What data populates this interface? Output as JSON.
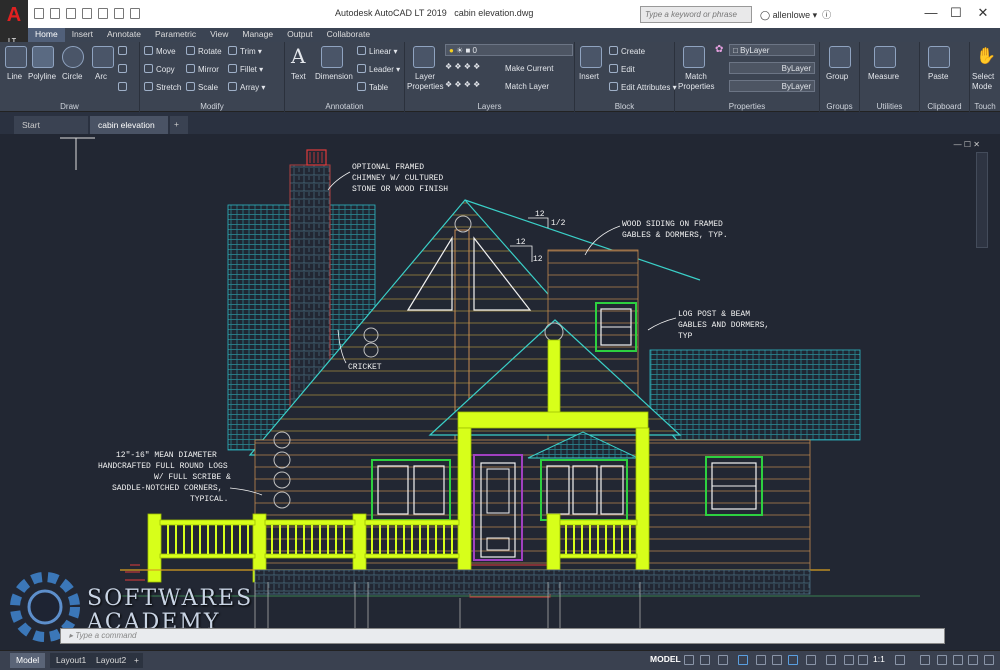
{
  "app": {
    "logo_text": "A",
    "logo_sub": "LT",
    "title": "Autodesk AutoCAD LT 2019",
    "filename": "cabin elevation.dwg",
    "search_placeholder": "Type a keyword or phrase",
    "user_name": "allenlowe"
  },
  "ribbon_tabs": [
    "Home",
    "Insert",
    "Annotate",
    "Parametric",
    "View",
    "Manage",
    "Output",
    "Collaborate"
  ],
  "ribbon": {
    "draw": {
      "label": "Draw",
      "line": "Line",
      "polyline": "Polyline",
      "circle": "Circle",
      "arc": "Arc"
    },
    "modify": {
      "label": "Modify",
      "move": "Move",
      "rotate": "Rotate",
      "trim": "Trim",
      "copy": "Copy",
      "mirror": "Mirror",
      "fillet": "Fillet",
      "stretch": "Stretch",
      "scale": "Scale",
      "array": "Array"
    },
    "annotation": {
      "label": "Annotation",
      "text": "Text",
      "dimension": "Dimension",
      "linear": "Linear",
      "leader": "Leader",
      "table": "Table"
    },
    "layers": {
      "label": "Layers",
      "layer_properties": "Layer Properties",
      "current_layer": "0",
      "make_current": "Make Current",
      "match_layer": "Match Layer"
    },
    "block": {
      "label": "Block",
      "insert": "Insert",
      "create": "Create",
      "edit": "Edit",
      "edit_attributes": "Edit Attributes"
    },
    "properties": {
      "label": "Properties",
      "match_properties": "Match Properties",
      "color": "ByLayer",
      "linetype": "ByLayer",
      "lineweight": "ByLayer"
    },
    "groups": {
      "label": "Groups",
      "group": "Group"
    },
    "utilities": {
      "label": "Utilities",
      "measure": "Measure"
    },
    "clipboard": {
      "label": "Clipboard",
      "paste": "Paste"
    },
    "touch": {
      "label": "Touch",
      "select_mode": "Select Mode"
    }
  },
  "doc_tabs": [
    "Start",
    "cabin elevation"
  ],
  "drawing_notes": {
    "chimney_1": "OPTIONAL FRAMED",
    "chimney_2": "CHIMNEY W/ CULTURED",
    "chimney_3": "STONE OR WOOD FINISH",
    "siding_1": "WOOD SIDING ON FRAMED",
    "siding_2": "GABLES & DORMERS, TYP.",
    "post_1": "LOG POST & BEAM",
    "post_2": "GABLES AND DORMERS,",
    "post_3": "TYP",
    "cricket": "CRICKET",
    "logs_1": "12\"-16\" MEAN DIAMETER",
    "logs_2": "HANDCRAFTED FULL ROUND LOGS",
    "logs_3": "W/ FULL SCRIBE &",
    "logs_4": "SADDLE-NOTCHED CORNERS,",
    "logs_5": "TYPICAL.",
    "pitch_run": "12",
    "pitch_rise": "1/2",
    "pitch2_run": "12",
    "pitch2_rise": "12"
  },
  "command_line": {
    "placeholder": "Type a command"
  },
  "layout_tabs": [
    "Model",
    "Layout1",
    "Layout2"
  ],
  "status": {
    "model": "MODEL",
    "scale": "1:1"
  },
  "watermark": {
    "line1": "SOFTWARES",
    "line2": "ACADEMY"
  },
  "colors": {
    "accent_green": "#d7ff1a",
    "cyan": "#2fb8c4",
    "magenta": "#a040c0",
    "red": "#e03b3b",
    "white": "#f2f2f2",
    "orange": "#d9a020"
  }
}
